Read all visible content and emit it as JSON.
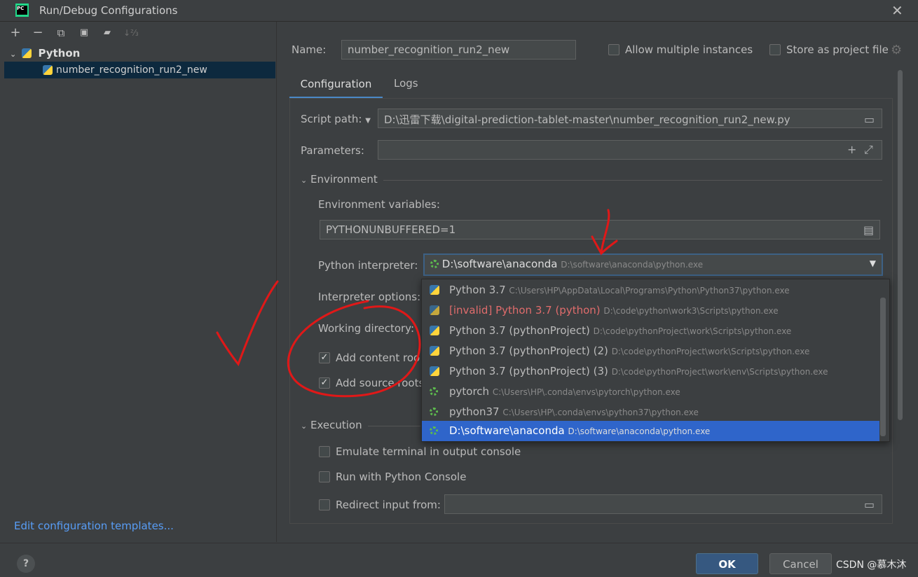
{
  "window": {
    "title": "Run/Debug Configurations"
  },
  "toolbar": {
    "add": "+",
    "remove": "−",
    "copy": "⧉",
    "save": "💾",
    "folder": "📁",
    "sort": "↓⅔"
  },
  "tree": {
    "group": "Python",
    "item": "number_recognition_run2_new",
    "edit_templates": "Edit configuration templates..."
  },
  "form": {
    "name_label": "Name:",
    "name_value": "number_recognition_run2_new",
    "allow_multiple": "Allow multiple instances",
    "store_project": "Store as project file",
    "tabs": [
      "Configuration",
      "Logs"
    ],
    "script_path_label": "Script path:",
    "script_path_value": "D:\\迅雷下载\\digital-prediction-tablet-master\\number_recognition_run2_new.py",
    "parameters_label": "Parameters:",
    "environment_section": "Environment",
    "env_vars_label": "Environment variables:",
    "env_vars_value": "PYTHONUNBUFFERED=1",
    "interpreter_label": "Python interpreter:",
    "interpreter_name": "D:\\software\\anaconda",
    "interpreter_path": "D:\\software\\anaconda\\python.exe",
    "interpreter_options_label": "Interpreter options:",
    "working_dir_label": "Working directory:",
    "add_content_roots": "Add content roo",
    "add_source_roots": "Add source roots",
    "execution_section": "Execution",
    "emulate_terminal": "Emulate terminal in output console",
    "run_with_console": "Run with Python Console",
    "redirect_input": "Redirect input from:"
  },
  "interpreters": [
    {
      "name": "Python 3.7",
      "path": "C:\\Users\\HP\\AppData\\Local\\Programs\\Python\\Python37\\python.exe",
      "icon": "python-icon"
    },
    {
      "name": "[invalid] Python 3.7 (python)",
      "path": "D:\\code\\python\\work3\\Scripts\\python.exe",
      "icon": "python-invalid-icon"
    },
    {
      "name": "Python 3.7 (pythonProject)",
      "path": "D:\\code\\pythonProject\\work\\Scripts\\python.exe",
      "icon": "python-icon"
    },
    {
      "name": "Python 3.7 (pythonProject) (2)",
      "path": "D:\\code\\pythonProject\\work\\Scripts\\python.exe",
      "icon": "python-icon"
    },
    {
      "name": "Python 3.7 (pythonProject) (3)",
      "path": "D:\\code\\pythonProject\\work\\env\\Scripts\\python.exe",
      "icon": "python-icon"
    },
    {
      "name": "pytorch",
      "path": "C:\\Users\\HP\\.conda\\envs\\pytorch\\python.exe",
      "icon": "conda-icon"
    },
    {
      "name": "python37",
      "path": "C:\\Users\\HP\\.conda\\envs\\python37\\python.exe",
      "icon": "conda-icon"
    },
    {
      "name": "D:\\software\\anaconda",
      "path": "D:\\software\\anaconda\\python.exe",
      "icon": "conda-icon"
    }
  ],
  "buttons": {
    "ok": "OK",
    "cancel": "Cancel",
    "help": "?"
  },
  "watermark": "CSDN @慕木沐",
  "colors": {
    "selection": "#2f65ca",
    "accent_tab": "#4a88c7",
    "annotation_red": "#e01818",
    "invalid": "#e06c6c"
  }
}
